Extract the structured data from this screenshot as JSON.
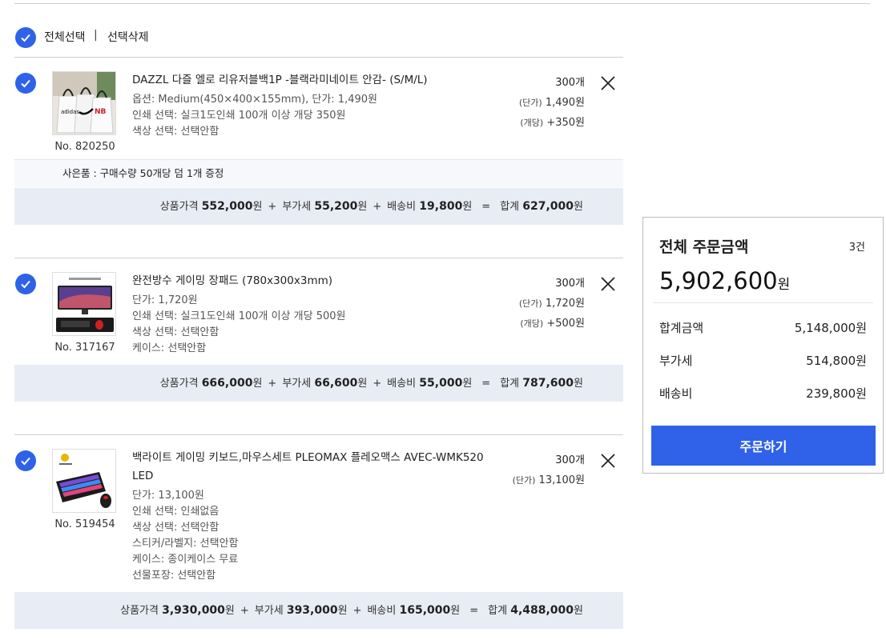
{
  "select_bar": {
    "select_all": "전체선택",
    "separator": "|",
    "delete_selected": "선택삭제"
  },
  "items": [
    {
      "no": "No. 820250",
      "title": "DAZZL 다즐 엘로 리유저블백1P -블랙라미네이트 안감- (S/M/L)",
      "options": [
        "옵션: Medium(450×400×155mm), 단가: 1,490원",
        "인쇄 선택: 실크1도인쇄 100개 이상 개당 350원",
        "색상 선택: 선택안함"
      ],
      "qty": "300개",
      "unit_label": "(단가)",
      "unit_price": "1,490원",
      "extra_label": "(개당)",
      "extra_price": "+350원",
      "gift": "사은품 : 구매수량 50개당 덤 1개 증정",
      "summary": {
        "product_label": "상품가격",
        "product": "552,000",
        "vat_label": "부가세",
        "vat": "55,200",
        "ship_label": "배송비",
        "ship": "19,800",
        "total_label": "합계",
        "total": "627,000",
        "won": "원"
      }
    },
    {
      "no": "No. 317167",
      "title": "완전방수 게이밍 장패드 (780x300x3mm)",
      "options": [
        "단가: 1,720원",
        "인쇄 선택: 실크1도인쇄 100개 이상 개당 500원",
        "색상 선택: 선택안함",
        "케이스: 선택안함"
      ],
      "qty": "300개",
      "unit_label": "(단가)",
      "unit_price": "1,720원",
      "extra_label": "(개당)",
      "extra_price": "+500원",
      "summary": {
        "product_label": "상품가격",
        "product": "666,000",
        "vat_label": "부가세",
        "vat": "66,600",
        "ship_label": "배송비",
        "ship": "55,000",
        "total_label": "합계",
        "total": "787,600",
        "won": "원"
      }
    },
    {
      "no": "No. 519454",
      "title_line1": "백라이트 게이밍 키보드,마우스세트 PLEOMAX 플레오맥스 AVEC-WMK520",
      "title_line2": "LED",
      "options": [
        "단가: 13,100원",
        "인쇄 선택: 인쇄없음",
        "색상 선택: 선택안함",
        "스티커/라벨지: 선택안함",
        "케이스: 종이케이스 무료",
        "선물포장: 선택안함"
      ],
      "qty": "300개",
      "unit_label": "(단가)",
      "unit_price": "13,100원",
      "summary": {
        "product_label": "상품가격",
        "product": "3,930,000",
        "vat_label": "부가세",
        "vat": "393,000",
        "ship_label": "배송비",
        "ship": "165,000",
        "total_label": "합계",
        "total": "4,488,000",
        "won": "원"
      }
    }
  ],
  "order_panel": {
    "title": "전체 주문금액",
    "count": "3건",
    "total": "5,902,600",
    "won": "원",
    "rows": [
      {
        "label": "합계금액",
        "value": "5,148,000원"
      },
      {
        "label": "부가세",
        "value": "514,800원"
      },
      {
        "label": "배송비",
        "value": "239,800원"
      }
    ],
    "button": "주문하기"
  },
  "colors": {
    "accent": "#2f62e8",
    "summary_bg": "#e8ecf4",
    "gift_bg": "#f7f8fb"
  }
}
